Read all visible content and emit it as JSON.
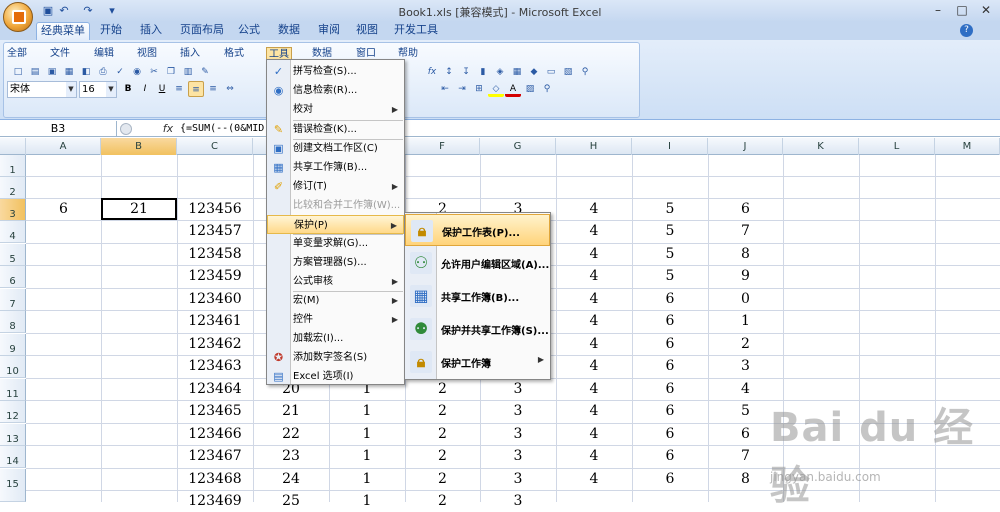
{
  "window": {
    "title": "Book1.xls  [兼容模式] - Microsoft Excel"
  },
  "tabs": [
    "经典菜单",
    "开始",
    "插入",
    "页面布局",
    "公式",
    "数据",
    "审阅",
    "视图",
    "开发工具"
  ],
  "menubar": [
    "全部",
    "文件",
    "编辑",
    "视图",
    "插入",
    "格式",
    "工具",
    "数据",
    "窗口",
    "帮助"
  ],
  "font": {
    "name": "宋体",
    "size": "16"
  },
  "formula_bar": {
    "name_box": "B3",
    "fx": "fx",
    "formula": "{=SUM(--(0&MID("
  },
  "columns": [
    "A",
    "B",
    "C",
    "D",
    "E",
    "F",
    "G",
    "H",
    "I",
    "J",
    "K",
    "L",
    "M"
  ],
  "rows": [
    "1",
    "2",
    "3",
    "4",
    "5",
    "6",
    "7",
    "8",
    "9",
    "10",
    "11",
    "12",
    "13",
    "14",
    "15"
  ],
  "cells": {
    "a3": "6",
    "b3": "21",
    "c": [
      "123456",
      "123457",
      "123458",
      "123459",
      "123460",
      "123461",
      "123462",
      "123463",
      "123464",
      "123465",
      "123466",
      "123467",
      "123468",
      "123469"
    ],
    "d": [
      "20",
      "21",
      "22",
      "23",
      "24",
      "25"
    ],
    "e": [
      "1",
      "1",
      "1",
      "1",
      "1",
      "1"
    ],
    "f": [
      "2",
      "2",
      "2",
      "2",
      "2",
      "2",
      "2"
    ],
    "g": [
      "3",
      "3",
      "3",
      "3",
      "3",
      "3",
      "3"
    ],
    "h": [
      "4",
      "4",
      "4",
      "4",
      "4",
      "4",
      "4",
      "4",
      "4",
      "4",
      "4",
      "4",
      "4"
    ],
    "i": [
      "5",
      "5",
      "5",
      "5",
      "6",
      "6",
      "6",
      "6",
      "6",
      "6",
      "6",
      "6",
      "6"
    ],
    "j": [
      "6",
      "7",
      "8",
      "9",
      "0",
      "1",
      "2",
      "3",
      "4",
      "5",
      "6",
      "7",
      "8"
    ]
  },
  "tools_menu": [
    {
      "label": "拼写检查(S)...",
      "icon": "spellcheck-icon"
    },
    {
      "label": "信息检索(R)...",
      "icon": "research-icon"
    },
    {
      "label": "校对",
      "icon": "",
      "submenu": true
    },
    {
      "label": "错误检查(K)...",
      "icon": "error-check-icon"
    },
    {
      "label": "创建文档工作区(C)",
      "icon": "workspace-icon"
    },
    {
      "label": "共享工作簿(B)...",
      "icon": "share-workbook-icon"
    },
    {
      "label": "修订(T)",
      "icon": "track-changes-icon",
      "submenu": true
    },
    {
      "label": "比较和合并工作簿(W)...",
      "icon": "",
      "disabled": true
    },
    {
      "label": "保护(P)",
      "icon": "",
      "submenu": true,
      "highlight": true
    },
    {
      "label": "单变量求解(G)...",
      "icon": ""
    },
    {
      "label": "方案管理器(S)...",
      "icon": ""
    },
    {
      "label": "公式审核",
      "icon": "",
      "submenu": true
    },
    {
      "label": "宏(M)",
      "icon": "",
      "submenu": true
    },
    {
      "label": "控件",
      "icon": "",
      "submenu": true
    },
    {
      "label": "加载宏(I)...",
      "icon": ""
    },
    {
      "label": "添加数字签名(S)",
      "icon": "signature-icon"
    },
    {
      "label": "Excel 选项(I)",
      "icon": "options-icon"
    }
  ],
  "protect_menu": [
    {
      "label": "保护工作表(P)...",
      "icon": "protect-sheet-icon"
    },
    {
      "label": "允许用户编辑区域(A)...",
      "icon": "allow-edit-ranges-icon"
    },
    {
      "label": "共享工作簿(B)...",
      "icon": "share-workbook-icon"
    },
    {
      "label": "保护并共享工作簿(S)...",
      "icon": "protect-share-icon"
    },
    {
      "label": "保护工作簿",
      "icon": "protect-workbook-icon",
      "submenu": true
    }
  ],
  "watermark": {
    "text": "Bai du 经验",
    "url": "jingyan.baidu.com"
  }
}
